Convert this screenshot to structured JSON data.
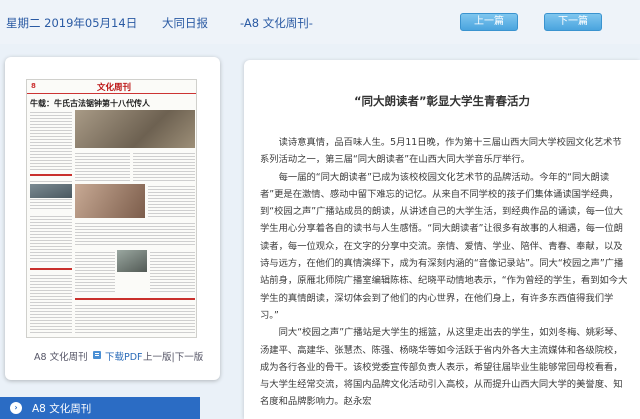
{
  "header": {
    "date": "星期二 2019年05月14日",
    "paper": "大同日报",
    "page": "-A8 文化周刊-",
    "prev_label": "上一篇",
    "next_label": "下一篇"
  },
  "thumbnail": {
    "page_num": "8",
    "section": "文化周刊",
    "headline": "牛载：牛氏古法锯钟第十八代传人",
    "footer_page": "A8 文化周刊",
    "pdf_label": "下载PDF",
    "prev_page": "上一版",
    "sep": "|",
    "next_page": "下一版"
  },
  "page_selector": {
    "label": "A8  文化周刊"
  },
  "article": {
    "title": "“同大朗读者”彰显大学生青春活力",
    "paragraphs": [
      "读诗意真情，品百味人生。5月11日晚，作为第十三届山西大同大学校园文化艺术节系列活动之一，第三届“同大朗读者”在山西大同大学音乐厅举行。",
      "每一届的“同大朗读者”已成为该校校园文化艺术节的品牌活动。今年的“同大朗读者”更是在激情、感动中留下难忘的记忆。从来自不同学校的孩子们集体诵读国学经典，到“校园之声”广播站成员的朗读，从讲述自己的大学生活，到经典作品的诵读，每一位大学生用心分享着各自的读书与人生感悟。“同大朗读者”让很多有故事的人相遇，每一位朗读者，每一位观众，在文字的分享中交流。亲情、爱情、学业、陪伴、青春、奉献，以及诗与远方，在他们的真情演绎下，成为有深刻内涵的“音像记录站”。同大“校园之声”广播站前身，原雁北师院广播室编辑陈栋、纪晓平动情地表示，“作为曾经的学生，看到如今大学生的真情朗读，深切体会到了他们的内心世界，在他们身上，有许多东西值得我们学习。”",
      "同大“校园之声”广播站是大学生的摇篮，从这里走出去的学生，如刘冬梅、姚彩琴、汤建平、高建华、张慧杰、陈强、杨晓华等如今活跃于省内外各大主流媒体和各级院校，成为各行各业的骨干。该校党委宣传部负责人表示，希望往届毕业生能够常回母校看看，与大学生经常交流，将国内品牌文化活动引入高校，从而提升山西大同大学的美誉度、知名度和品牌影响力。赵永宏"
    ]
  },
  "colors": {
    "accent": "#2b6cc4",
    "header_text": "#2a5aa3",
    "button": "#4aa4de",
    "background": "#eaf1f8"
  }
}
